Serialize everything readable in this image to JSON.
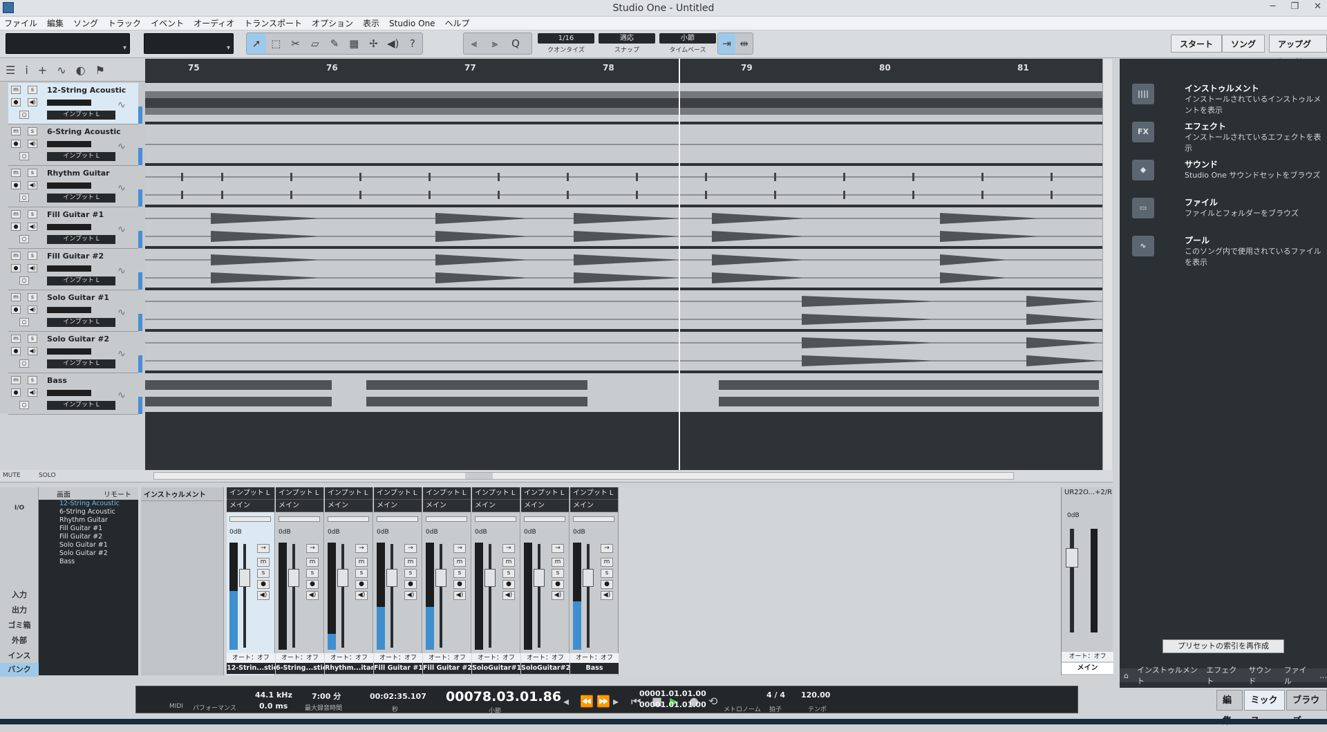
{
  "window": {
    "title": "Studio One - Untitled",
    "controls": [
      "─",
      "❐",
      "✕"
    ]
  },
  "menu": [
    "ファイル",
    "編集",
    "ソング",
    "トラック",
    "イベント",
    "オーディオ",
    "トランスポート",
    "オプション",
    "表示",
    "Studio One",
    "ヘルプ"
  ],
  "toolbar": {
    "quantize": {
      "value": "1/16",
      "label": "クオンタイズ"
    },
    "snap": {
      "value": "適応",
      "label": "スナップ"
    },
    "timebase": {
      "value": "小節",
      "label": "タイムベース"
    },
    "start": "スタート",
    "song": "ソング",
    "upgrade": "アップグレード"
  },
  "ruler": {
    "bars": [
      "75",
      "76",
      "77",
      "78",
      "79",
      "80",
      "81"
    ]
  },
  "tracks": [
    {
      "name": "12-String Acoustic",
      "input": "インプット L"
    },
    {
      "name": "6-String Acoustic",
      "input": "インプット L"
    },
    {
      "name": "Rhythm Guitar",
      "input": "インプット L"
    },
    {
      "name": "Fill Guitar #1",
      "input": "インプット L"
    },
    {
      "name": "Fill Guitar #2",
      "input": "インプット L"
    },
    {
      "name": "Solo Guitar #1",
      "input": "インプット L"
    },
    {
      "name": "Solo Guitar #2",
      "input": "インプット L"
    },
    {
      "name": "Bass",
      "input": "インプット L"
    }
  ],
  "status": {
    "mute": "MUTE",
    "solo": "SOLO"
  },
  "browser": {
    "items": [
      {
        "title": "インストゥルメント",
        "desc": "インストールされているインストゥルメントを表示",
        "icon": "||||"
      },
      {
        "title": "エフェクト",
        "desc": "インストールされているエフェクトを表示",
        "icon": "FX"
      },
      {
        "title": "サウンド",
        "desc": "Studio One サウンドセットをブラウズ",
        "icon": "◆"
      },
      {
        "title": "ファイル",
        "desc": "ファイルとフォルダーをブラウズ",
        "icon": "▭"
      },
      {
        "title": "プール",
        "desc": "このソング内で使用されているファイルを表示",
        "icon": "∿"
      }
    ],
    "rebuild": "プリセットの索引を再作成",
    "tabs": [
      "⌂",
      "インストゥルメント",
      "エフェクト",
      "サウンド",
      "ファイル",
      "…"
    ]
  },
  "mixer": {
    "tabs": [
      "画面",
      "リモート"
    ],
    "io": "I/O",
    "left_buttons": [
      "入力",
      "出力",
      "ゴミ箱",
      "外部",
      "インスト...",
      "バンク"
    ],
    "list": [
      "12-String Acoustic",
      "6-String Acoustic",
      "Rhythm Guitar",
      "Fill Guitar #1",
      "Fill Guitar #2",
      "Solo Guitar #1",
      "Solo Guitar #2",
      "Bass"
    ],
    "instruments": "インストゥルメント",
    "channels": [
      {
        "input": "インプット L",
        "out": "メイン",
        "db": "0dB",
        "auto": "オート：オフ",
        "name": "12-Strin...stic",
        "level": 0.55
      },
      {
        "input": "インプット L",
        "out": "メイン",
        "db": "0dB",
        "auto": "オート：オフ",
        "name": "6-String...stic",
        "level": 0.0
      },
      {
        "input": "インプット L",
        "out": "メイン",
        "db": "0dB",
        "auto": "オート：オフ",
        "name": "Rhythm...itar",
        "level": 0.15
      },
      {
        "input": "インプット L",
        "out": "メイン",
        "db": "0dB",
        "auto": "オート：オフ",
        "name": "Fill Guitar #1",
        "level": 0.4
      },
      {
        "input": "インプット L",
        "out": "メイン",
        "db": "0dB",
        "auto": "オート：オフ",
        "name": "Fill Guitar #2",
        "level": 0.4
      },
      {
        "input": "インプット L",
        "out": "メイン",
        "db": "0dB",
        "auto": "オート：オフ",
        "name": "SoloGuitar#1",
        "level": 0.0
      },
      {
        "input": "インプット L",
        "out": "メイン",
        "db": "0dB",
        "auto": "オート：オフ",
        "name": "SoloGuitar#2",
        "level": 0.0
      },
      {
        "input": "インプット L",
        "out": "メイン",
        "db": "0dB",
        "auto": "オート：オフ",
        "name": "Bass",
        "level": 0.45
      }
    ],
    "main": {
      "device": "UR22O...+2/R",
      "db": "0dB",
      "auto": "オート：オフ",
      "name": "メイン"
    }
  },
  "transport": {
    "midi": "MIDI",
    "perf": "パフォーマンス",
    "rate": "44.1 kHz",
    "latency": "0.0 ms",
    "rectime": "7:00 分",
    "rectime_label": "最大録音時間",
    "seconds": "00:02:35.107",
    "seconds_label": "秒",
    "position": "00078.03.01.86",
    "position_label": "小節",
    "loop_l": "00001.01.01.00",
    "loop_r": "00001.01.01.00",
    "metronome": "メトロノーム",
    "sig": "4 / 4",
    "sig_label": "拍子",
    "tempo": "120.00",
    "tempo_label": "テンポ"
  },
  "views": [
    "編集",
    "ミックス",
    "ブラウズ"
  ]
}
